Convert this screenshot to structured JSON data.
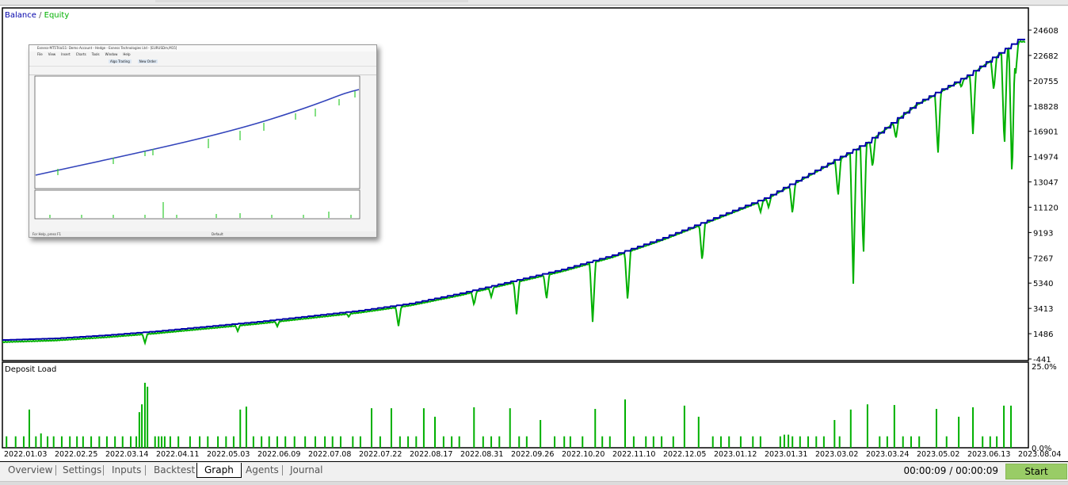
{
  "chart_data": [
    {
      "type": "line",
      "legend": {
        "balance_label": "Balance",
        "separator": " / ",
        "equity_label": "Equity",
        "placement": "top-left"
      },
      "colors": {
        "balance": "#0000aa",
        "equity": "#00b000"
      },
      "x_tick_labels": [
        "2022.01.03",
        "2022.02.25",
        "2022.03.14",
        "2022.04.11",
        "2022.05.03",
        "2022.06.09",
        "2022.07.08",
        "2022.07.22",
        "2022.08.17",
        "2022.08.31",
        "2022.09.26",
        "2022.10.20",
        "2022.11.10",
        "2022.12.05",
        "2023.01.12",
        "2023.01.31",
        "2023.03.02",
        "2023.03.24",
        "2023.05.02",
        "2023.06.13",
        "2023.08.04"
      ],
      "y_tick_labels": [
        "24608",
        "22682",
        "20755",
        "18828",
        "16901",
        "14974",
        "13047",
        "11120",
        "9193",
        "7267",
        "5340",
        "3413",
        "1486",
        "-441"
      ],
      "ylim": [
        -441,
        24608
      ],
      "grid": false,
      "balance": [
        1008,
        1128,
        1370,
        1672,
        2034,
        2396,
        2819,
        3242,
        3785,
        4570,
        5475,
        6380,
        7467,
        8796,
        10305,
        11814,
        13927,
        16040,
        19058,
        21172,
        23888
      ],
      "balance_end": {
        "x": 20.15,
        "y": 23888
      },
      "equity_drawdowns": [
        {
          "x": 2.78,
          "y": 766
        },
        {
          "x": 4.61,
          "y": 1672
        },
        {
          "x": 5.39,
          "y": 2034
        },
        {
          "x": 6.8,
          "y": 2758
        },
        {
          "x": 7.78,
          "y": 2034
        },
        {
          "x": 9.27,
          "y": 3664
        },
        {
          "x": 9.61,
          "y": 4268
        },
        {
          "x": 10.11,
          "y": 2940
        },
        {
          "x": 10.7,
          "y": 4087
        },
        {
          "x": 11.61,
          "y": 2336
        },
        {
          "x": 12.3,
          "y": 3966
        },
        {
          "x": 13.77,
          "y": 6985
        },
        {
          "x": 14.92,
          "y": 10727
        },
        {
          "x": 15.08,
          "y": 11090
        },
        {
          "x": 15.55,
          "y": 10607
        },
        {
          "x": 16.45,
          "y": 11935
        },
        {
          "x": 16.75,
          "y": 5294
        },
        {
          "x": 16.95,
          "y": 7286
        },
        {
          "x": 17.13,
          "y": 14108
        },
        {
          "x": 17.59,
          "y": 16342
        },
        {
          "x": 18.42,
          "y": 15134
        },
        {
          "x": 18.88,
          "y": 20266
        },
        {
          "x": 19.11,
          "y": 16644
        },
        {
          "x": 19.52,
          "y": 19964
        },
        {
          "x": 19.73,
          "y": 15557
        },
        {
          "x": 19.88,
          "y": 13142
        },
        {
          "x": 19.95,
          "y": 21172
        }
      ]
    },
    {
      "type": "bar",
      "title": "Deposit Load",
      "color": "#00b000",
      "y_tick_labels": [
        "25.0%",
        "0.0%"
      ],
      "ylim": [
        0,
        25
      ],
      "bars": [
        [
          0.05,
          3.5
        ],
        [
          0.23,
          3.5
        ],
        [
          0.39,
          3.5
        ],
        [
          0.5,
          11.7
        ],
        [
          0.63,
          3.5
        ],
        [
          0.73,
          4.4
        ],
        [
          0.86,
          3.5
        ],
        [
          0.98,
          3.5
        ],
        [
          1.14,
          3.5
        ],
        [
          1.3,
          3.5
        ],
        [
          1.44,
          3.5
        ],
        [
          1.56,
          3.5
        ],
        [
          1.72,
          3.5
        ],
        [
          1.88,
          3.5
        ],
        [
          2.03,
          3.5
        ],
        [
          2.19,
          3.5
        ],
        [
          2.34,
          3.5
        ],
        [
          2.5,
          3.5
        ],
        [
          2.61,
          3.5
        ],
        [
          2.67,
          10.9
        ],
        [
          2.72,
          13.3
        ],
        [
          2.78,
          19.9
        ],
        [
          2.83,
          18.7
        ],
        [
          2.98,
          3.5
        ],
        [
          3.05,
          3.5
        ],
        [
          3.11,
          3.5
        ],
        [
          3.17,
          3.5
        ],
        [
          3.28,
          3.5
        ],
        [
          3.44,
          3.5
        ],
        [
          3.67,
          3.5
        ],
        [
          3.86,
          3.5
        ],
        [
          4.02,
          3.5
        ],
        [
          4.22,
          3.5
        ],
        [
          4.38,
          3.5
        ],
        [
          4.53,
          3.5
        ],
        [
          4.66,
          11.7
        ],
        [
          4.78,
          12.6
        ],
        [
          4.92,
          3.5
        ],
        [
          5.08,
          3.5
        ],
        [
          5.23,
          3.5
        ],
        [
          5.39,
          3.5
        ],
        [
          5.55,
          3.5
        ],
        [
          5.73,
          3.5
        ],
        [
          5.94,
          3.5
        ],
        [
          6.14,
          3.5
        ],
        [
          6.33,
          3.5
        ],
        [
          6.48,
          3.5
        ],
        [
          6.64,
          3.5
        ],
        [
          6.88,
          3.5
        ],
        [
          7.03,
          3.5
        ],
        [
          7.25,
          12.1
        ],
        [
          7.42,
          3.5
        ],
        [
          7.64,
          12.1
        ],
        [
          7.81,
          3.5
        ],
        [
          7.97,
          3.5
        ],
        [
          8.13,
          3.5
        ],
        [
          8.28,
          12.1
        ],
        [
          8.5,
          9.5
        ],
        [
          8.67,
          3.5
        ],
        [
          8.83,
          3.5
        ],
        [
          8.98,
          3.5
        ],
        [
          9.27,
          12.4
        ],
        [
          9.45,
          3.5
        ],
        [
          9.61,
          3.5
        ],
        [
          9.77,
          3.5
        ],
        [
          9.98,
          12.1
        ],
        [
          10.16,
          3.5
        ],
        [
          10.31,
          3.5
        ],
        [
          10.58,
          8.5
        ],
        [
          10.86,
          3.5
        ],
        [
          11.05,
          3.5
        ],
        [
          11.17,
          3.5
        ],
        [
          11.41,
          3.5
        ],
        [
          11.66,
          11.9
        ],
        [
          11.8,
          3.5
        ],
        [
          11.95,
          3.5
        ],
        [
          12.25,
          14.8
        ],
        [
          12.42,
          3.5
        ],
        [
          12.66,
          3.5
        ],
        [
          12.81,
          3.5
        ],
        [
          12.97,
          3.5
        ],
        [
          13.2,
          3.5
        ],
        [
          13.42,
          12.9
        ],
        [
          13.7,
          9.5
        ],
        [
          13.98,
          3.5
        ],
        [
          14.14,
          3.5
        ],
        [
          14.3,
          3.5
        ],
        [
          14.53,
          3.5
        ],
        [
          14.77,
          3.5
        ],
        [
          14.92,
          3.5
        ],
        [
          15.31,
          3.5
        ],
        [
          15.39,
          4
        ],
        [
          15.47,
          4
        ],
        [
          15.55,
          3.5
        ],
        [
          15.7,
          3.5
        ],
        [
          15.86,
          3.5
        ],
        [
          16.02,
          3.5
        ],
        [
          16.17,
          3.5
        ],
        [
          16.38,
          8.5
        ],
        [
          16.48,
          3.5
        ],
        [
          16.7,
          11.7
        ],
        [
          17.03,
          13.3
        ],
        [
          17.27,
          3.5
        ],
        [
          17.42,
          3.5
        ],
        [
          17.56,
          13.1
        ],
        [
          17.73,
          3.5
        ],
        [
          17.89,
          3.5
        ],
        [
          18.05,
          3.5
        ],
        [
          18.39,
          11.9
        ],
        [
          18.59,
          3.5
        ],
        [
          18.83,
          9.5
        ],
        [
          19.11,
          12.4
        ],
        [
          19.3,
          3.5
        ],
        [
          19.45,
          3.5
        ],
        [
          19.58,
          3.5
        ],
        [
          19.72,
          12.9
        ],
        [
          19.86,
          12.9
        ]
      ]
    }
  ],
  "inset": {
    "title": "Exness-MT5Trial11: Demo Account - Hedge - Exness Technologies Ltd - [EURUSDm,M15]",
    "menu": [
      "File",
      "View",
      "Insert",
      "Charts",
      "Tools",
      "Window",
      "Help"
    ],
    "toolbar": [
      "Algo Trading",
      "New Order"
    ],
    "status_left": "For Help, press F1",
    "status_mid": "Default"
  },
  "tabs": [
    "Overview",
    "Settings",
    "Inputs",
    "Backtest",
    "Graph",
    "Agents",
    "Journal"
  ],
  "active_tab": "Graph",
  "timer": "00:00:09 / 00:00:09",
  "start_label": "Start"
}
